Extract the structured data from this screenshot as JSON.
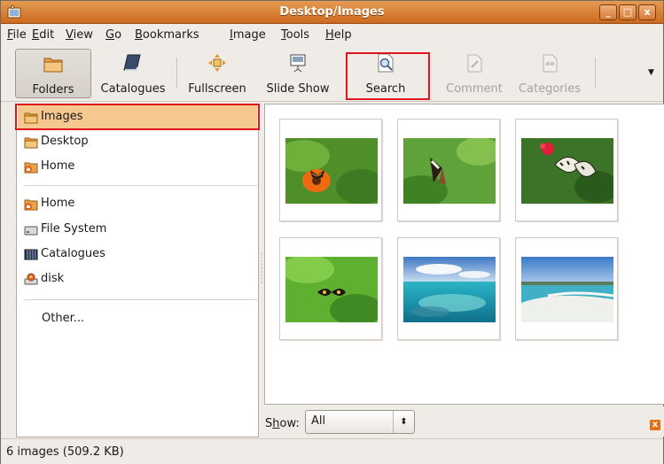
{
  "window": {
    "title": "Desktop/Images",
    "minimize": "_",
    "maximize": "□",
    "close": "x"
  },
  "menu": [
    {
      "pre": "",
      "u": "F",
      "post": "ile"
    },
    {
      "pre": "",
      "u": "E",
      "post": "dit"
    },
    {
      "pre": "",
      "u": "V",
      "post": "iew"
    },
    {
      "pre": "",
      "u": "G",
      "post": "o"
    },
    {
      "pre": "",
      "u": "B",
      "post": "ookmarks"
    },
    {
      "pre": "",
      "u": "I",
      "post": "mage"
    },
    {
      "pre": "",
      "u": "T",
      "post": "ools"
    },
    {
      "pre": "",
      "u": "H",
      "post": "elp"
    }
  ],
  "toolbar": {
    "folders": "Folders",
    "catalogues": "Catalogues",
    "fullscreen": "Fullscreen",
    "slideshow": "Slide Show",
    "search": "Search",
    "comment": "Comment",
    "categories": "Categories",
    "overflow": "▼"
  },
  "sidebar": {
    "images": "Images",
    "desktop": "Desktop",
    "home1": "Home",
    "home2": "Home",
    "filesystem": "File System",
    "catalogues": "Catalogues",
    "disk": "disk",
    "other": "Other..."
  },
  "showbar": {
    "label_pre": "S",
    "label_u": "h",
    "label_post": "ow:",
    "value": "All",
    "arrow": "⬍",
    "close": "x"
  },
  "status": "6 images (509.2 KB)",
  "colors": {
    "titlebar": "#cc6a1f",
    "selection": "#f5c88f",
    "highlight_box": "#e0151d"
  }
}
